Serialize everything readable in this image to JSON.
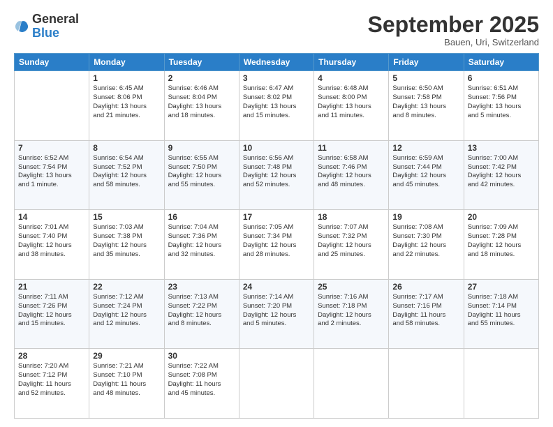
{
  "logo": {
    "general": "General",
    "blue": "Blue"
  },
  "title": "September 2025",
  "location": "Bauen, Uri, Switzerland",
  "weekdays": [
    "Sunday",
    "Monday",
    "Tuesday",
    "Wednesday",
    "Thursday",
    "Friday",
    "Saturday"
  ],
  "weeks": [
    [
      {
        "day": "",
        "info": ""
      },
      {
        "day": "1",
        "info": "Sunrise: 6:45 AM\nSunset: 8:06 PM\nDaylight: 13 hours\nand 21 minutes."
      },
      {
        "day": "2",
        "info": "Sunrise: 6:46 AM\nSunset: 8:04 PM\nDaylight: 13 hours\nand 18 minutes."
      },
      {
        "day": "3",
        "info": "Sunrise: 6:47 AM\nSunset: 8:02 PM\nDaylight: 13 hours\nand 15 minutes."
      },
      {
        "day": "4",
        "info": "Sunrise: 6:48 AM\nSunset: 8:00 PM\nDaylight: 13 hours\nand 11 minutes."
      },
      {
        "day": "5",
        "info": "Sunrise: 6:50 AM\nSunset: 7:58 PM\nDaylight: 13 hours\nand 8 minutes."
      },
      {
        "day": "6",
        "info": "Sunrise: 6:51 AM\nSunset: 7:56 PM\nDaylight: 13 hours\nand 5 minutes."
      }
    ],
    [
      {
        "day": "7",
        "info": "Sunrise: 6:52 AM\nSunset: 7:54 PM\nDaylight: 13 hours\nand 1 minute."
      },
      {
        "day": "8",
        "info": "Sunrise: 6:54 AM\nSunset: 7:52 PM\nDaylight: 12 hours\nand 58 minutes."
      },
      {
        "day": "9",
        "info": "Sunrise: 6:55 AM\nSunset: 7:50 PM\nDaylight: 12 hours\nand 55 minutes."
      },
      {
        "day": "10",
        "info": "Sunrise: 6:56 AM\nSunset: 7:48 PM\nDaylight: 12 hours\nand 52 minutes."
      },
      {
        "day": "11",
        "info": "Sunrise: 6:58 AM\nSunset: 7:46 PM\nDaylight: 12 hours\nand 48 minutes."
      },
      {
        "day": "12",
        "info": "Sunrise: 6:59 AM\nSunset: 7:44 PM\nDaylight: 12 hours\nand 45 minutes."
      },
      {
        "day": "13",
        "info": "Sunrise: 7:00 AM\nSunset: 7:42 PM\nDaylight: 12 hours\nand 42 minutes."
      }
    ],
    [
      {
        "day": "14",
        "info": "Sunrise: 7:01 AM\nSunset: 7:40 PM\nDaylight: 12 hours\nand 38 minutes."
      },
      {
        "day": "15",
        "info": "Sunrise: 7:03 AM\nSunset: 7:38 PM\nDaylight: 12 hours\nand 35 minutes."
      },
      {
        "day": "16",
        "info": "Sunrise: 7:04 AM\nSunset: 7:36 PM\nDaylight: 12 hours\nand 32 minutes."
      },
      {
        "day": "17",
        "info": "Sunrise: 7:05 AM\nSunset: 7:34 PM\nDaylight: 12 hours\nand 28 minutes."
      },
      {
        "day": "18",
        "info": "Sunrise: 7:07 AM\nSunset: 7:32 PM\nDaylight: 12 hours\nand 25 minutes."
      },
      {
        "day": "19",
        "info": "Sunrise: 7:08 AM\nSunset: 7:30 PM\nDaylight: 12 hours\nand 22 minutes."
      },
      {
        "day": "20",
        "info": "Sunrise: 7:09 AM\nSunset: 7:28 PM\nDaylight: 12 hours\nand 18 minutes."
      }
    ],
    [
      {
        "day": "21",
        "info": "Sunrise: 7:11 AM\nSunset: 7:26 PM\nDaylight: 12 hours\nand 15 minutes."
      },
      {
        "day": "22",
        "info": "Sunrise: 7:12 AM\nSunset: 7:24 PM\nDaylight: 12 hours\nand 12 minutes."
      },
      {
        "day": "23",
        "info": "Sunrise: 7:13 AM\nSunset: 7:22 PM\nDaylight: 12 hours\nand 8 minutes."
      },
      {
        "day": "24",
        "info": "Sunrise: 7:14 AM\nSunset: 7:20 PM\nDaylight: 12 hours\nand 5 minutes."
      },
      {
        "day": "25",
        "info": "Sunrise: 7:16 AM\nSunset: 7:18 PM\nDaylight: 12 hours\nand 2 minutes."
      },
      {
        "day": "26",
        "info": "Sunrise: 7:17 AM\nSunset: 7:16 PM\nDaylight: 11 hours\nand 58 minutes."
      },
      {
        "day": "27",
        "info": "Sunrise: 7:18 AM\nSunset: 7:14 PM\nDaylight: 11 hours\nand 55 minutes."
      }
    ],
    [
      {
        "day": "28",
        "info": "Sunrise: 7:20 AM\nSunset: 7:12 PM\nDaylight: 11 hours\nand 52 minutes."
      },
      {
        "day": "29",
        "info": "Sunrise: 7:21 AM\nSunset: 7:10 PM\nDaylight: 11 hours\nand 48 minutes."
      },
      {
        "day": "30",
        "info": "Sunrise: 7:22 AM\nSunset: 7:08 PM\nDaylight: 11 hours\nand 45 minutes."
      },
      {
        "day": "",
        "info": ""
      },
      {
        "day": "",
        "info": ""
      },
      {
        "day": "",
        "info": ""
      },
      {
        "day": "",
        "info": ""
      }
    ]
  ]
}
